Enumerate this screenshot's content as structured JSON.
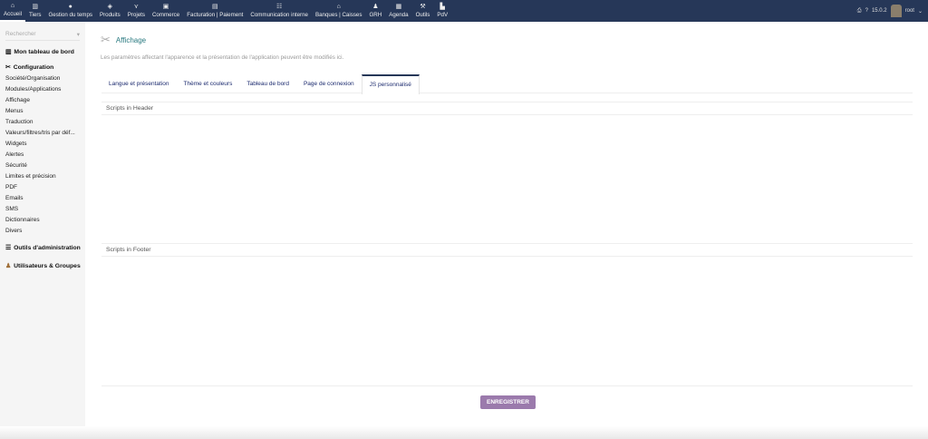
{
  "topmenu": [
    {
      "label": "Accueil",
      "icon": "home-icon",
      "glyph": "⌂"
    },
    {
      "label": "Tiers",
      "icon": "building-icon",
      "glyph": "▥"
    },
    {
      "label": "Gestion du temps",
      "icon": "clock-icon",
      "glyph": "●"
    },
    {
      "label": "Produits",
      "icon": "cube-icon",
      "glyph": "◈"
    },
    {
      "label": "Projets",
      "icon": "project-icon",
      "glyph": "⋎"
    },
    {
      "label": "Commerce",
      "icon": "briefcase-icon",
      "glyph": "▣"
    },
    {
      "label": "Facturation | Paiement",
      "icon": "invoice-icon",
      "glyph": "▤"
    },
    {
      "label": "Communication interne",
      "icon": "team-icon",
      "glyph": "☷"
    },
    {
      "label": "Banques | Caisses",
      "icon": "bank-icon",
      "glyph": "⌂"
    },
    {
      "label": "GRH",
      "icon": "user-tie-icon",
      "glyph": "♟"
    },
    {
      "label": "Agenda",
      "icon": "calendar-icon",
      "glyph": "▦"
    },
    {
      "label": "Outils",
      "icon": "wrench-icon",
      "glyph": "⚒"
    },
    {
      "label": "PdV",
      "icon": "cash-register-icon",
      "glyph": "▙"
    }
  ],
  "topright": {
    "version": "15.0.2",
    "user": "root"
  },
  "sidebar": {
    "search_placeholder": "Rechercher",
    "dashboard": "Mon tableau de bord",
    "config": "Configuration",
    "items": [
      "Société/Organisation",
      "Modules/Applications",
      "Affichage",
      "Menus",
      "Traduction",
      "Valeurs/filtres/tris par déf...",
      "Widgets",
      "Alertes",
      "Sécurité",
      "Limites et précision",
      "PDF",
      "Emails",
      "SMS",
      "Dictionnaires",
      "Divers"
    ],
    "admin_tools": "Outils d'administration",
    "users_groups": "Utilisateurs & Groupes"
  },
  "main": {
    "title": "Affichage",
    "description": "Les paramètres affectant l'apparence et la présentation de l'application peuvent être modifiés ici.",
    "tabs": [
      "Langue et présentation",
      "Thème et couleurs",
      "Tableau de bord",
      "Page de connexion",
      "JS personnalisé"
    ],
    "header_label": "Scripts in Header",
    "footer_label": "Scripts in Footer",
    "save": "ENREGISTRER"
  }
}
